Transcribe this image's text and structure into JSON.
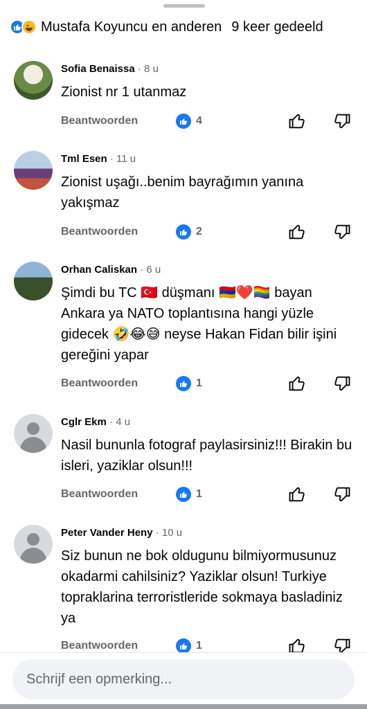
{
  "header": {
    "reaction_icons": [
      "like-icon",
      "haha-icon"
    ],
    "names": "Mustafa Koyuncu en anderen",
    "shares": "9 keer gedeeld"
  },
  "comments": [
    {
      "author": "Sofia Benaissa",
      "time": "· 8 u",
      "avatar": "photo",
      "text": "Zionist nr 1 utanmaz",
      "reply_label": "Beantwoorden",
      "like_count": "4"
    },
    {
      "author": "Tml Esen",
      "time": "· 11 u",
      "avatar": "photo",
      "text": "Zionist uşağı..benim bayrağımın yanına yakışmaz",
      "reply_label": "Beantwoorden",
      "like_count": "2"
    },
    {
      "author": "Orhan Caliskan",
      "time": "· 6 u",
      "avatar": "photo",
      "text": "Şimdi bu TC 🇹🇷 düşmanı 🇦🇲❤️🏳️‍🌈 bayan Ankara ya NATO toplantısına hangi yüzle gidecek 🤣😂😅 neyse Hakan Fidan bilir işini  gereğini yapar",
      "reply_label": "Beantwoorden",
      "like_count": "1"
    },
    {
      "author": "Cglr Ekm",
      "time": "· 4 u",
      "avatar": "default",
      "text": "Nasil bununla fotograf paylasirsiniz!!! Birakin bu isleri, yaziklar olsun!!!",
      "reply_label": "Beantwoorden",
      "like_count": "1"
    },
    {
      "author": "Peter Vander Heny",
      "time": "· 10 u",
      "avatar": "default",
      "text": "Siz bunun ne bok oldugunu bilmiyormusunuz okadarmi cahilsiniz? Yaziklar olsun! Turkiye topraklarina terroristleride sokmaya basladiniz ya",
      "reply_label": "Beantwoorden",
      "like_count": "1"
    }
  ],
  "composer": {
    "placeholder": "Schrijf een opmerking..."
  },
  "colors": {
    "accent": "#1877f2",
    "secondary_text": "#65676b"
  }
}
